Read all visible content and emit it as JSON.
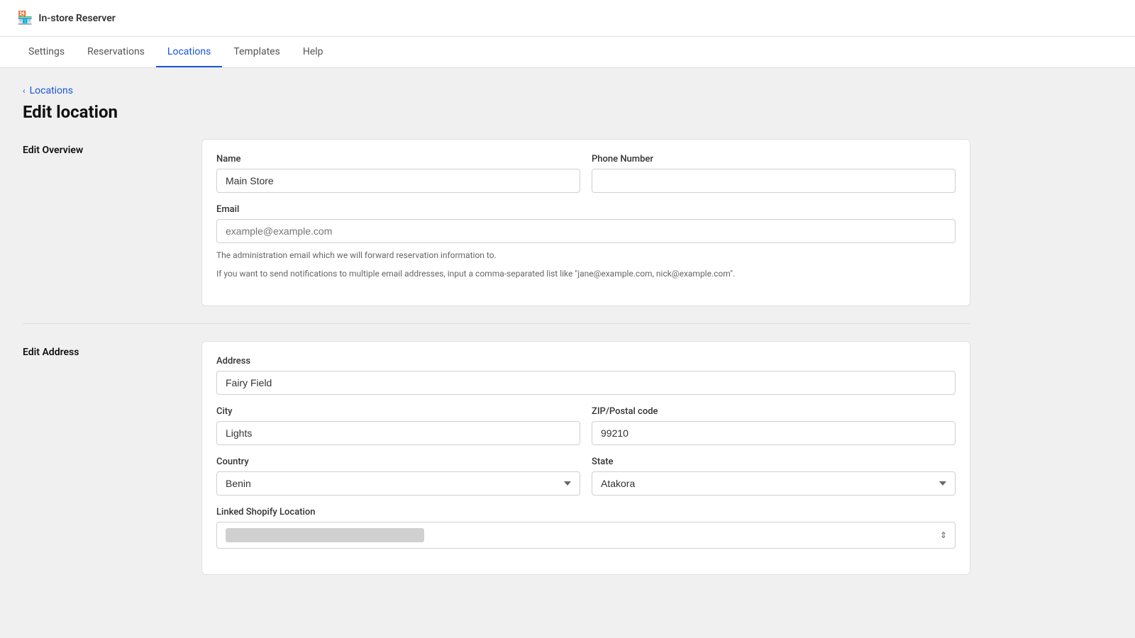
{
  "app": {
    "name": "In-store Reserver"
  },
  "nav": {
    "tabs": [
      {
        "id": "settings",
        "label": "Settings",
        "active": false
      },
      {
        "id": "reservations",
        "label": "Reservations",
        "active": false
      },
      {
        "id": "locations",
        "label": "Locations",
        "active": true
      },
      {
        "id": "templates",
        "label": "Templates",
        "active": false
      },
      {
        "id": "help",
        "label": "Help",
        "active": false
      }
    ]
  },
  "breadcrumb": {
    "label": "Locations"
  },
  "page": {
    "title": "Edit location"
  },
  "overview": {
    "section_label": "Edit Overview",
    "name_label": "Name",
    "name_value": "Main Store",
    "phone_label": "Phone Number",
    "phone_value": "",
    "email_label": "Email",
    "email_placeholder": "example@example.com",
    "email_value": "",
    "help_text_1": "The administration email which we will forward reservation information to.",
    "help_text_2": "If you want to send notifications to multiple email addresses, input a comma-separated list like \"jane@example.com, nick@example.com\"."
  },
  "address": {
    "section_label": "Edit Address",
    "address_label": "Address",
    "address_value": "Fairy Field",
    "city_label": "City",
    "city_value": "Lights",
    "zip_label": "ZIP/Postal code",
    "zip_value": "99210",
    "country_label": "Country",
    "country_value": "Benin",
    "state_label": "State",
    "state_value": "Atakora",
    "linked_label": "Linked Shopify Location",
    "country_options": [
      "Benin"
    ],
    "state_options": [
      "Atakora"
    ]
  },
  "colors": {
    "accent": "#1a56db"
  }
}
